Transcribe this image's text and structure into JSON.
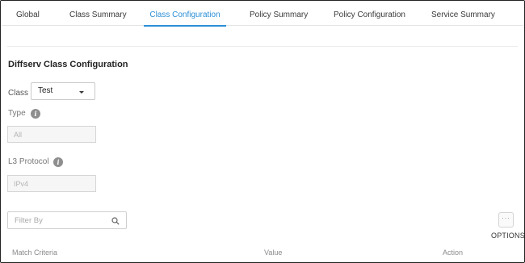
{
  "tabs": [
    {
      "label": "Global",
      "active": false
    },
    {
      "label": "Class Summary",
      "active": false
    },
    {
      "label": "Class Configuration",
      "active": true
    },
    {
      "label": "Policy Summary",
      "active": false
    },
    {
      "label": "Policy Configuration",
      "active": false
    },
    {
      "label": "Service Summary",
      "active": false
    }
  ],
  "colors": {
    "accent": "#2b8fd6"
  },
  "section": {
    "title": "Diffserv Class Configuration"
  },
  "form": {
    "class_label": "Class",
    "class_value": "Test",
    "type_label": "Type",
    "type_value": "All",
    "l3_label": "L3 Protocol",
    "l3_value": "IPv4",
    "info_icon_glyph": "i"
  },
  "filter": {
    "placeholder": "Filter By"
  },
  "options": {
    "label": "OPTIONS",
    "icon_glyph": "···"
  },
  "table": {
    "columns": [
      "Match Criteria",
      "Value",
      "Action"
    ]
  }
}
